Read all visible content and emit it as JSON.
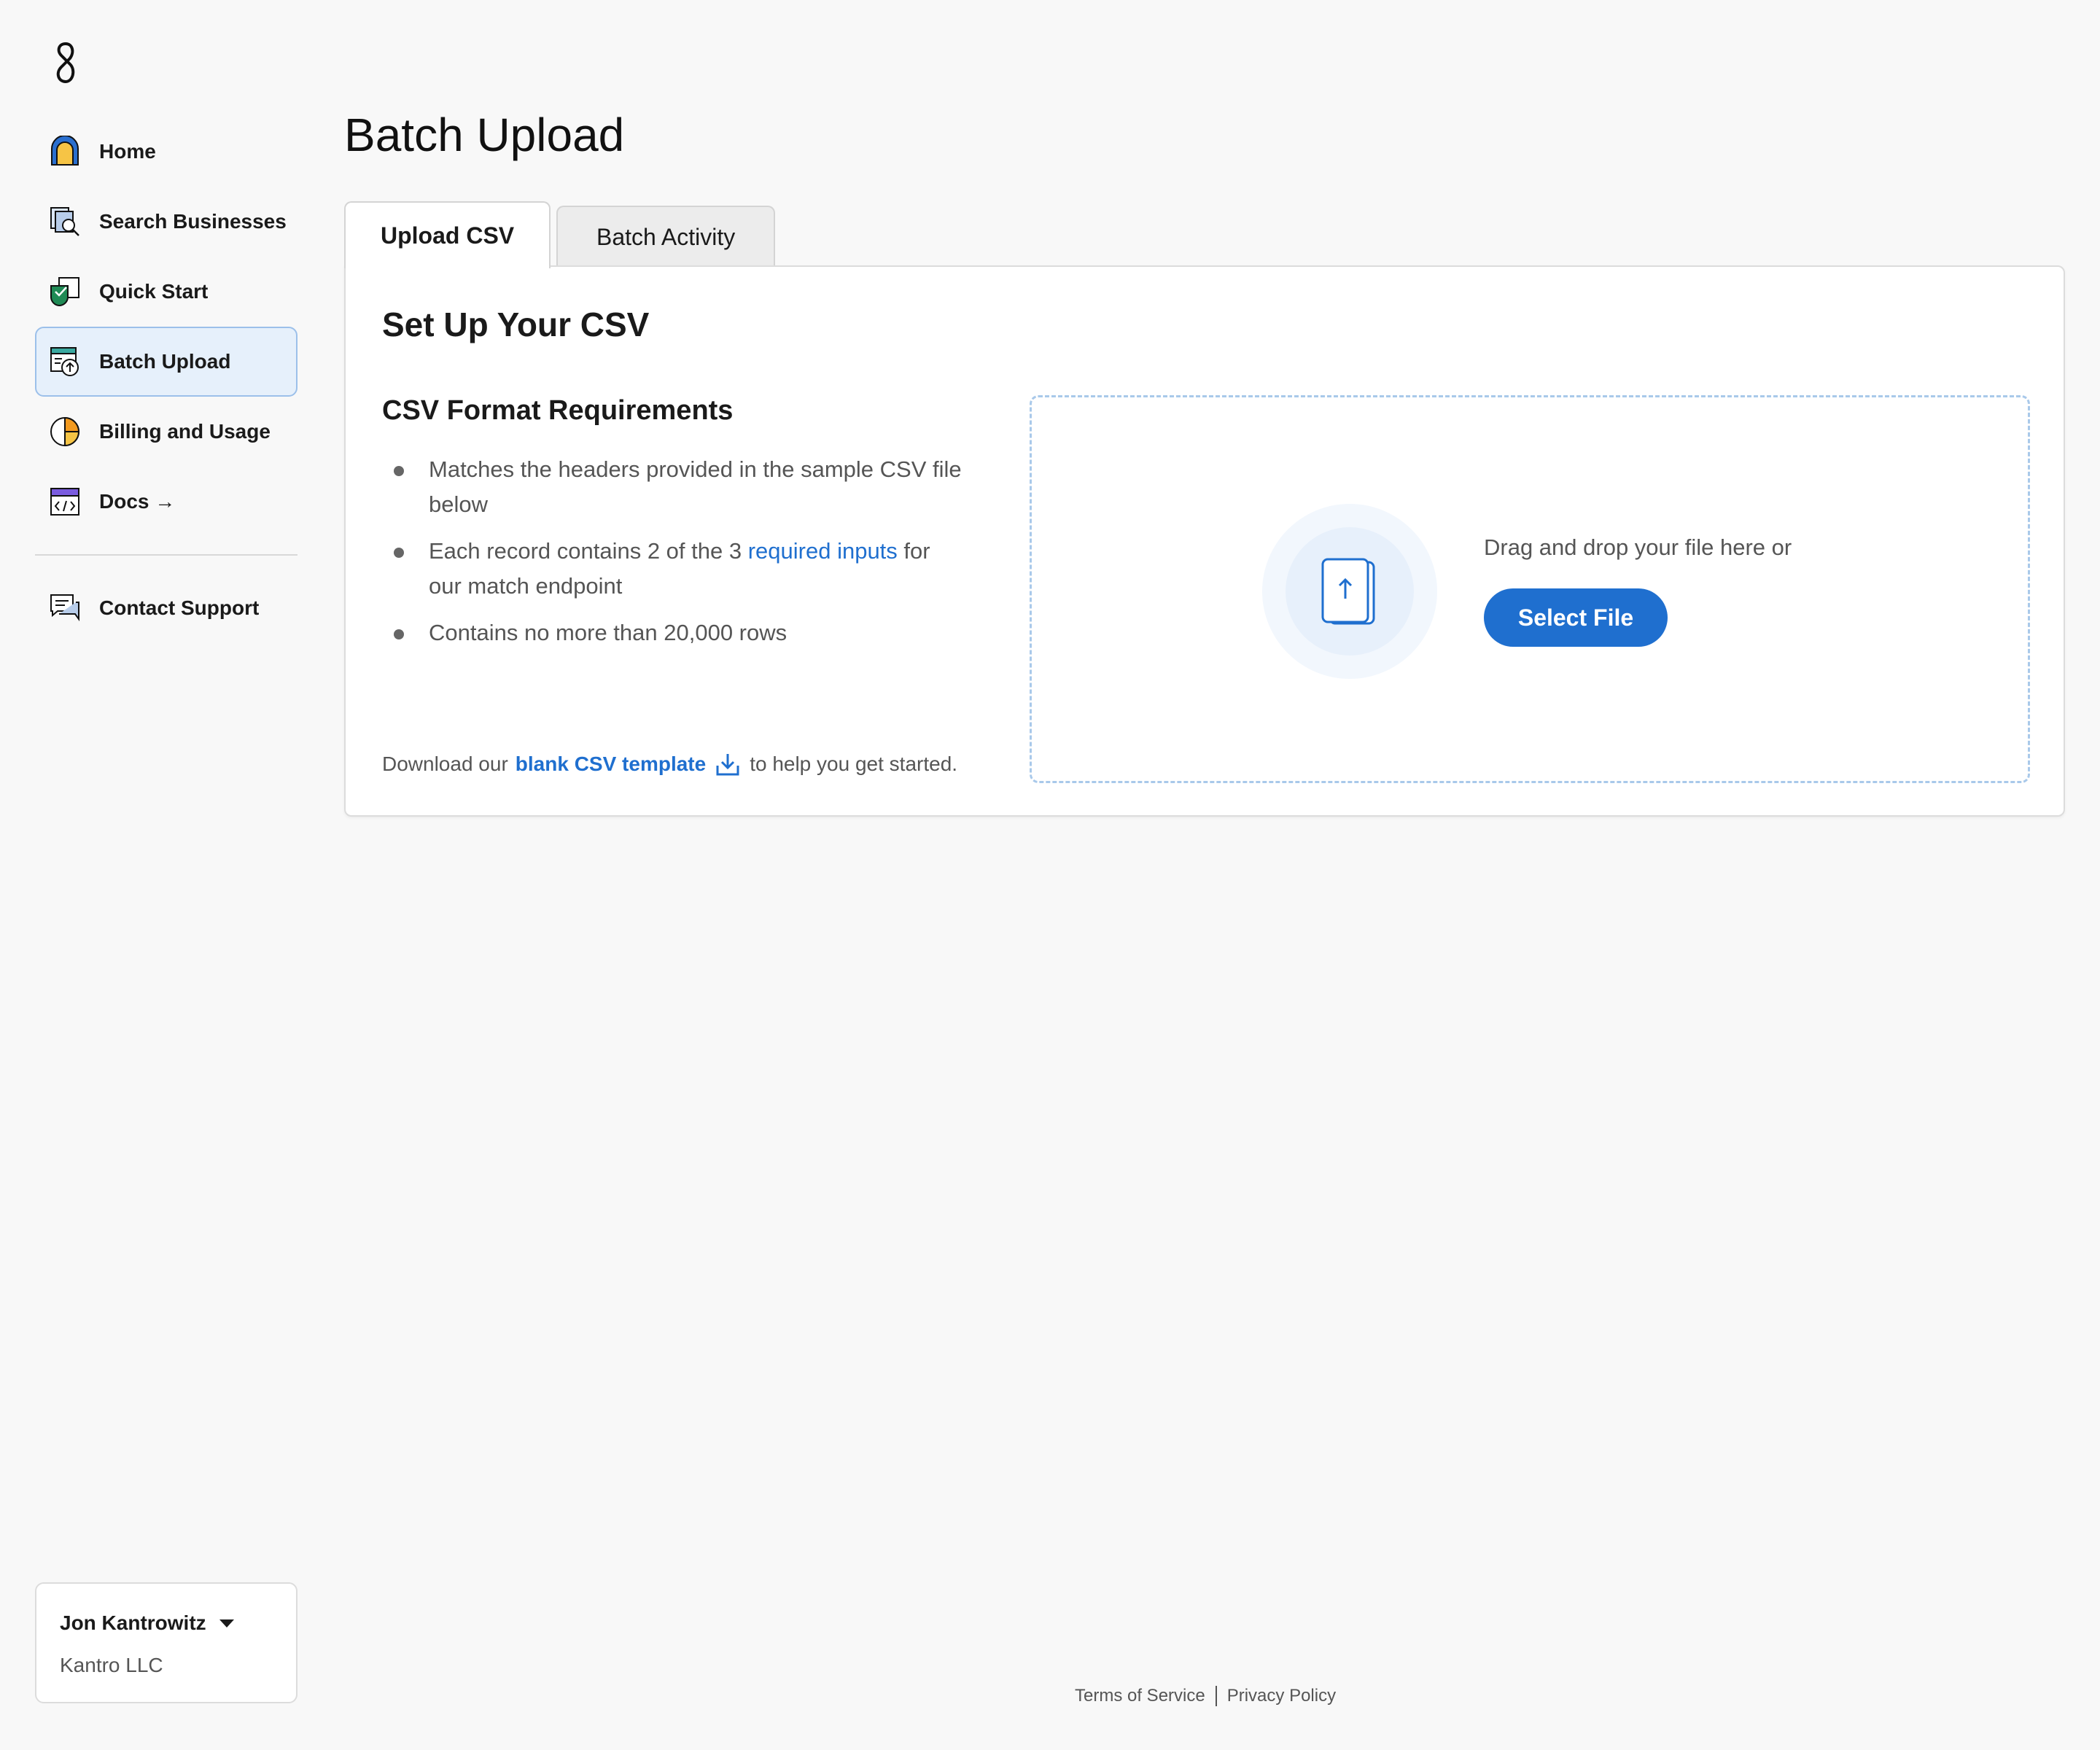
{
  "sidebar": {
    "items": [
      {
        "label": "Home",
        "icon": "home-icon"
      },
      {
        "label": "Search Businesses",
        "icon": "search-businesses-icon"
      },
      {
        "label": "Quick Start",
        "icon": "quick-start-icon"
      },
      {
        "label": "Batch Upload",
        "icon": "batch-upload-icon",
        "active": true
      },
      {
        "label": "Billing and Usage",
        "icon": "billing-icon"
      },
      {
        "label": "Docs →",
        "icon": "docs-icon"
      }
    ],
    "support": {
      "label": "Contact Support",
      "icon": "chat-icon"
    }
  },
  "user": {
    "name": "Jon Kantrowitz",
    "org": "Kantro LLC"
  },
  "main": {
    "title": "Batch Upload",
    "tabs": [
      {
        "label": "Upload CSV",
        "active": true
      },
      {
        "label": "Batch Activity",
        "active": false
      }
    ],
    "card": {
      "title": "Set Up Your CSV",
      "requirements_title": "CSV Format Requirements",
      "requirements": [
        {
          "text": "Matches the headers provided in the sample CSV file below"
        },
        {
          "before": "Each record contains 2 of the 3 ",
          "link": "required inputs",
          "after": " for our match endpoint"
        },
        {
          "text": "Contains no more than 20,000 rows"
        }
      ],
      "download": {
        "prefix": "Download our",
        "link": "blank CSV template",
        "suffix": "to help you get started."
      },
      "dropzone": {
        "text": "Drag and drop your file here or",
        "button": "Select File"
      }
    }
  },
  "footer": {
    "terms": "Terms of Service",
    "privacy": "Privacy Policy"
  },
  "colors": {
    "accent": "#1f6fcf",
    "active_nav_bg": "#e6f0fb",
    "background": "#f8f8f8"
  }
}
